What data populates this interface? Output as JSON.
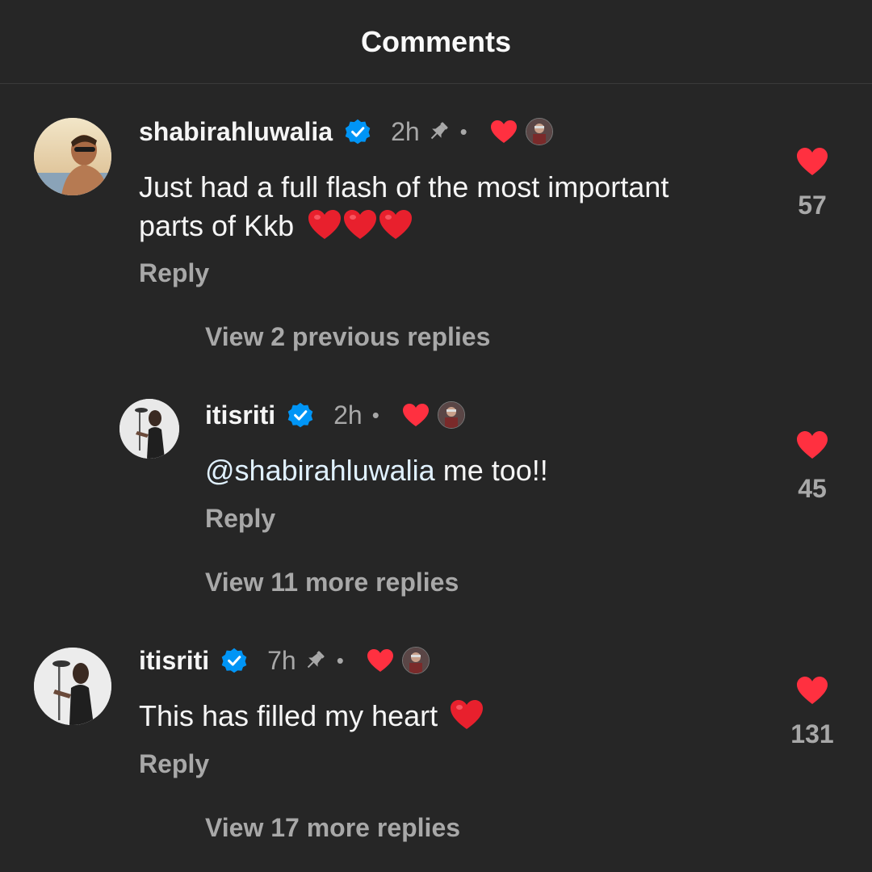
{
  "header": {
    "title": "Comments"
  },
  "colors": {
    "background": "#262626",
    "heart": "#ff3040",
    "verified": "#0095f6",
    "secondary_text": "#a8a8a8"
  },
  "comments": [
    {
      "username": "shabirahluwalia",
      "verified": true,
      "time": "2h",
      "pinned": true,
      "dot": "•",
      "text_lines": [
        "Just had a full flash of the most important",
        "parts of Kkb"
      ],
      "emojis": [
        "red-heart",
        "red-heart",
        "red-heart"
      ],
      "reply_label": "Reply",
      "like_count": "57"
    },
    {
      "view_previous": "View 2 previous replies",
      "username": "itisriti",
      "verified": true,
      "time": "2h",
      "pinned": false,
      "dot": "•",
      "mention": "@shabirahluwalia",
      "text": " me too!!",
      "reply_label": "Reply",
      "like_count": "45",
      "view_more": "View 11 more replies"
    },
    {
      "username": "itisriti",
      "verified": true,
      "time": "7h",
      "pinned": true,
      "dot": "•",
      "text": "This has filled my heart",
      "emojis": [
        "red-heart"
      ],
      "reply_label": "Reply",
      "like_count": "131",
      "view_more": "View 17 more replies"
    }
  ]
}
